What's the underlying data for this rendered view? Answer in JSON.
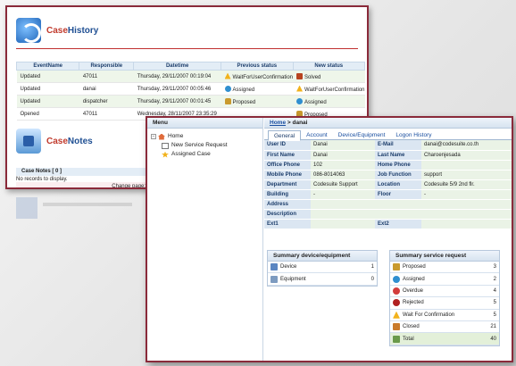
{
  "case_history": {
    "title_part1": "Case",
    "title_part2": "History",
    "columns": [
      "EventName",
      "Responsible",
      "Datetime",
      "Previous status",
      "New status"
    ],
    "rows": [
      {
        "event": "Updated",
        "responsible": "47011",
        "datetime": "Thursday, 29/11/2007 00:19:04",
        "prev": "WaitForUserConfirmation",
        "new": "Solved"
      },
      {
        "event": "Updated",
        "responsible": "danai",
        "datetime": "Thursday, 29/11/2007 00:05:46",
        "prev": "Assigned",
        "new": "WaitForUserConfirmation"
      },
      {
        "event": "Updated",
        "responsible": "dispatcher",
        "datetime": "Thursday, 29/11/2007 00:01:45",
        "prev": "Proposed",
        "new": "Assigned"
      },
      {
        "event": "Opened",
        "responsible": "47011",
        "datetime": "Wednesday, 28/11/2007 23:35:29",
        "prev": "",
        "new": "Proposed"
      }
    ]
  },
  "case_notes": {
    "title_part1": "Case",
    "title_part2": "Notes",
    "header": "Case Notes [ 0 ]",
    "empty": "No records to display.",
    "pager": "Change page:  Pre"
  },
  "menu": {
    "title": "Menu",
    "home": "Home",
    "items": [
      "New Service Request",
      "Assigned Case"
    ]
  },
  "breadcrumb": {
    "home": "Home",
    "sep": ">",
    "current": "danai"
  },
  "tabs": [
    "General",
    "Account",
    "Device/Equipment",
    "Logon History"
  ],
  "user": {
    "rows": [
      {
        "l1": "User ID",
        "v1": "Danai",
        "l2": "E-Mail",
        "v2": "danai@codesuite.co.th"
      },
      {
        "l1": "First Name",
        "v1": "Danai",
        "l2": "Last Name",
        "v2": "Charoenjesada"
      },
      {
        "l1": "Office Phone",
        "v1": "102",
        "l2": "Home Phone",
        "v2": ""
      },
      {
        "l1": "Mobile Phone",
        "v1": "086-8014063",
        "l2": "Job Function",
        "v2": "support"
      },
      {
        "l1": "Department",
        "v1": "Codesuite Support",
        "l2": "Location",
        "v2": "Codesuite 5/9 2nd flr."
      },
      {
        "l1": "Building",
        "v1": "-",
        "l2": "Floor",
        "v2": "-"
      },
      {
        "l1": "Address",
        "v1": "",
        "l2": "",
        "v2": ""
      },
      {
        "l1": "Description",
        "v1": "",
        "l2": "",
        "v2": ""
      },
      {
        "l1": "Ext1",
        "v1": "",
        "l2": "Ext2",
        "v2": ""
      }
    ]
  },
  "summary_device": {
    "title": "Summary device/equipment",
    "rows": [
      {
        "label": "Device",
        "value": "1"
      },
      {
        "label": "Equipment",
        "value": "0"
      }
    ]
  },
  "summary_service": {
    "title": "Summary service request",
    "rows": [
      {
        "label": "Proposed",
        "value": "3"
      },
      {
        "label": "Assigned",
        "value": "2"
      },
      {
        "label": "Overdue",
        "value": "4"
      },
      {
        "label": "Rejected",
        "value": "5"
      },
      {
        "label": "Wait For Confirmation",
        "value": "5"
      },
      {
        "label": "Closed",
        "value": "21"
      },
      {
        "label": "Total",
        "value": "40"
      }
    ]
  }
}
